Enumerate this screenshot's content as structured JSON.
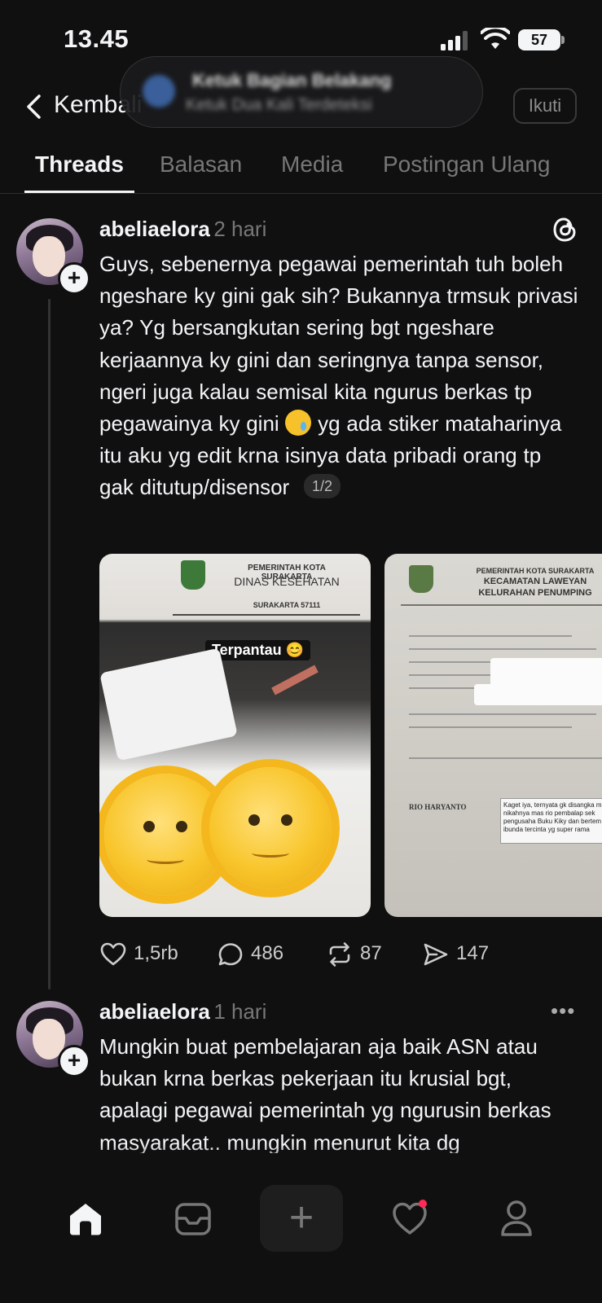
{
  "status_bar": {
    "time": "13.45",
    "battery": "57"
  },
  "header": {
    "back_label": "Kembali",
    "notification_title": "Ketuk Bagian Belakang",
    "notification_sub": "Ketuk Dua Kali Terdeteksi",
    "follow_label": "Ikuti"
  },
  "tabs": [
    {
      "label": "Threads",
      "active": true
    },
    {
      "label": "Balasan",
      "active": false
    },
    {
      "label": "Media",
      "active": false
    },
    {
      "label": "Postingan Ulang",
      "active": false
    }
  ],
  "posts": [
    {
      "username": "abeliaelora",
      "time_ago": "2 hari",
      "text_before_emoji": "Guys, sebenernya pegawai pemerintah tuh boleh ngeshare ky gini gak sih? Bukannya trmsuk privasi ya? Yg bersangkutan sering bgt ngeshare kerjaannya ky gini dan seringnya tanpa sensor, ngeri juga kalau semisal kita ngurus berkas tp pegawainya ky gini",
      "text_after_emoji": "yg ada stiker mataharinya itu aku yg edit krna isinya data pribadi orang tp gak ditutup/disensor",
      "page_indicator": "1/2",
      "image1": {
        "doc_header": "PEMERINTAH KOTA SURAKARTA",
        "doc_subheader": "DINAS KESEHATAN",
        "doc_city": "SURAKARTA 57111",
        "sticker": "Terpantau 😊"
      },
      "image2": {
        "doc_header": "PEMERINTAH KOTA SURAKARTA",
        "doc_subheader": "KECAMATAN LAWEYAN",
        "doc_subheader2": "KELURAHAN PENUMPING",
        "name": "RIO HARYANTO",
        "caption": "Kaget iya, ternyata gk disangka m nikahnya mas rio pembalap sek pengusaha Buku Kiky dan bertem ibunda tercinta yg super rama"
      },
      "likes": "1,5rb",
      "replies": "486",
      "reposts": "87",
      "shares": "147"
    },
    {
      "username": "abeliaelora",
      "time_ago": "1 hari",
      "text": "Mungkin buat pembelajaran aja baik ASN atau bukan krna berkas pekerjaan itu krusial bgt, apalagi pegawai pemerintah yg ngurusin berkas masyarakat.. mungkin menurut kita dg mengupload berkas kerjaan bikin terlihat"
    }
  ],
  "colors": {
    "background": "#101010",
    "text": "#f3f5f7",
    "muted": "#777777",
    "notification_dot": "#ff2a55"
  },
  "icons": [
    "back-chevron-icon",
    "threads-logo-icon",
    "heart-icon",
    "comment-icon",
    "repost-icon",
    "share-icon",
    "more-icon",
    "home-icon",
    "inbox-icon",
    "plus-icon",
    "activity-heart-icon",
    "profile-icon"
  ]
}
